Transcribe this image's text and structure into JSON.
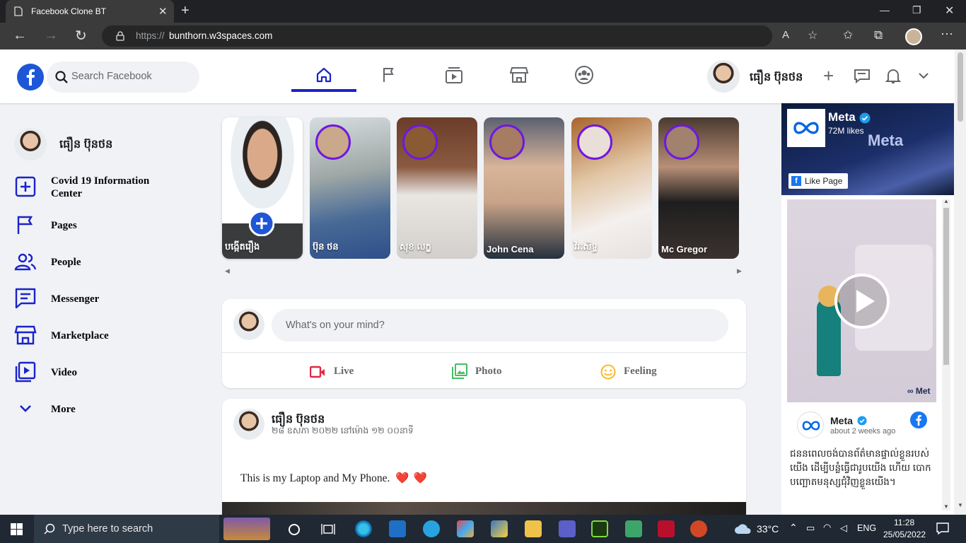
{
  "browser": {
    "tab_title": "Facebook Clone BT",
    "url_prefix": "https://",
    "url_host": "bunthorn.w3spaces.com"
  },
  "header": {
    "search_placeholder": "Search Facebook",
    "user_name": "ធឿន ប៊ុនថន",
    "nav_icons": [
      "home-icon",
      "flag-icon",
      "video-icon",
      "marketplace-icon",
      "groups-icon"
    ],
    "active_nav": "home",
    "accent": "#1a23c9"
  },
  "sidebar": {
    "profile_name": "ធឿន ប៊ុនថន",
    "items": [
      {
        "label": "Covid 19 Information Center",
        "icon": "plus-box-icon"
      },
      {
        "label": "Pages",
        "icon": "flag-icon"
      },
      {
        "label": "People",
        "icon": "people-icon"
      },
      {
        "label": "Messenger",
        "icon": "message-icon"
      },
      {
        "label": "Marketplace",
        "icon": "store-icon"
      },
      {
        "label": "Video",
        "icon": "video-icon"
      },
      {
        "label": "More",
        "icon": "chevron-down-icon"
      }
    ]
  },
  "stories": [
    {
      "name": "បង្កើតរឿង"
    },
    {
      "name": "ប៊ុន ថន"
    },
    {
      "name": "សុខ លក្ខ"
    },
    {
      "name": "John Cena"
    },
    {
      "name": "វិរៈសិទ្ធ"
    },
    {
      "name": "Mc Gregor"
    }
  ],
  "composer": {
    "placeholder": "What's on your mind?",
    "actions": [
      {
        "label": "Live",
        "color": "#e42645"
      },
      {
        "label": "Photo",
        "color": "#45bd62"
      },
      {
        "label": "Feeling",
        "color": "#f7b928"
      }
    ]
  },
  "post": {
    "author": "ធឿន ប៊ុនថន",
    "date": "២៨ ឧសភា ២០២២ នៅម៉ោង ១២ ០០នាទី",
    "text": "This is my Laptop and My Phone."
  },
  "ad": {
    "page_name": "Meta",
    "likes": "72M likes",
    "like_button": "Like Page",
    "brand": "Meta",
    "post_name": "Meta",
    "post_time": "about 2 weeks ago",
    "post_text": "ជនន​ពេលចង់បានព័ត៌មានផ្ទាល់ខ្លួនរបស់យើង ដើម្បីបន្លំធ្វើជារូបយើង ហើយ បោកបញ្ឆោតមនុស្សជុំវិញខ្លួនយើង។",
    "video_brand": "∞ Met"
  },
  "taskbar": {
    "search_placeholder": "Type here to search",
    "weather": "33°C",
    "language": "ENG",
    "time": "11:28",
    "date": "25/05/2022"
  }
}
